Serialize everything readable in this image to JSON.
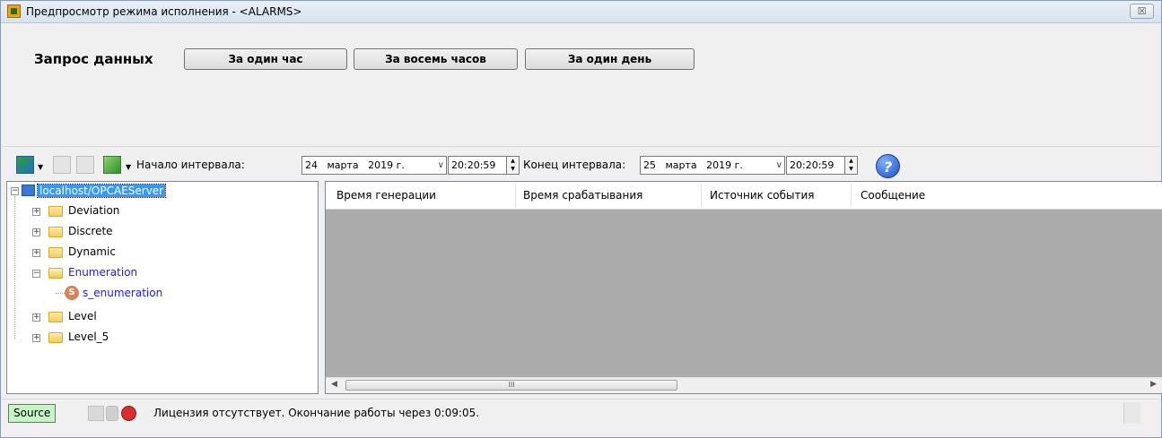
{
  "window": {
    "title": "Предпросмотр режима исполнения - <ALARMS>",
    "close_label": "☒"
  },
  "query": {
    "label": "Запрос данных",
    "buttons": [
      "За один час",
      "За восемь часов",
      "За один день"
    ]
  },
  "toolbar": {
    "start_label": "Начало интервала:",
    "start_date": "24   марта   2019 г.",
    "start_time": "20:20:59",
    "end_label": "Конец интервала:",
    "end_date": "25   марта   2019 г.",
    "end_time": "20:20:59",
    "help_label": "?"
  },
  "tree": {
    "root": "localhost/OPCAEServer",
    "items": [
      {
        "label": "Deviation",
        "expanded": false
      },
      {
        "label": "Discrete",
        "expanded": false
      },
      {
        "label": "Dynamic",
        "expanded": false
      },
      {
        "label": "Enumeration",
        "expanded": true
      },
      {
        "label": "s_enumeration",
        "leaf": true
      },
      {
        "label": "Level",
        "expanded": false
      },
      {
        "label": "Level_5",
        "expanded": false
      }
    ]
  },
  "grid": {
    "columns": [
      "Время генерации",
      "Время срабатывания",
      "Источник события",
      "Сообщение"
    ],
    "scroll_thumb": "III"
  },
  "status": {
    "source_label": "Source",
    "message": "Лицензия отсутствует. Окончание работы через 0:09:05."
  },
  "colors": {
    "selection": "#3399ff",
    "active_node": "#1a1aff",
    "source_bg": "#c6f5c6"
  }
}
